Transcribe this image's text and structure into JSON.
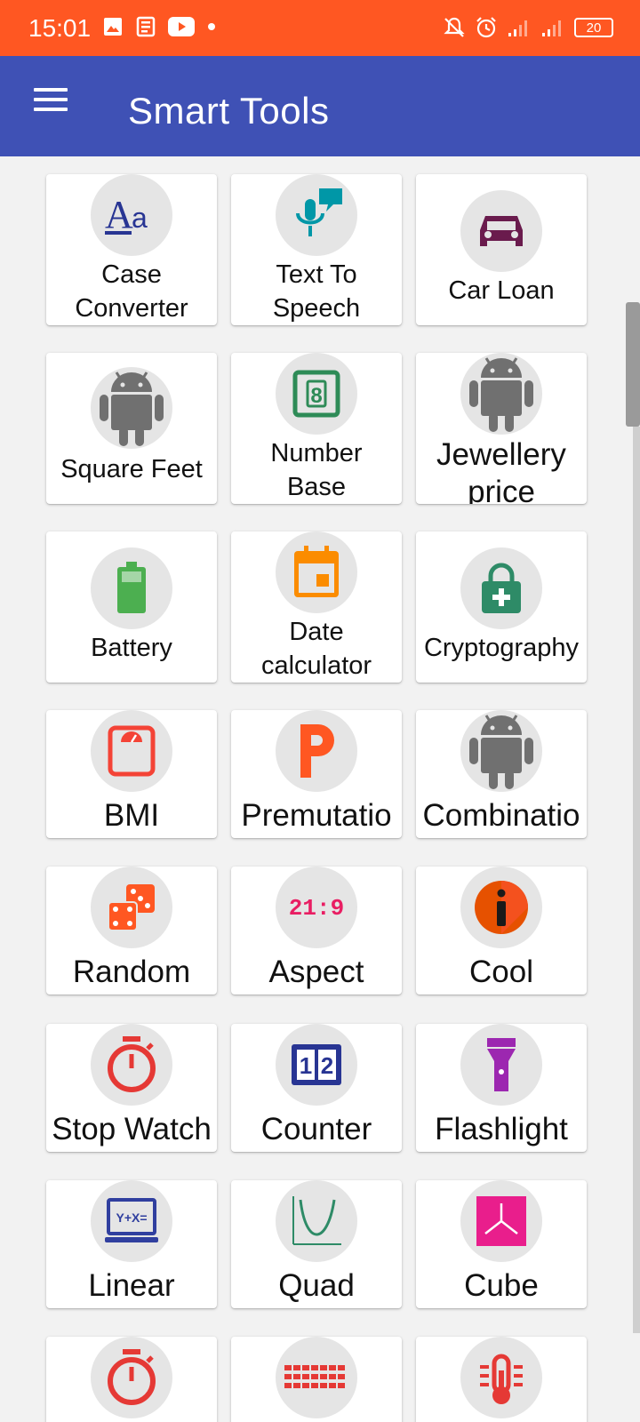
{
  "status_bar": {
    "time": "15:01",
    "battery": "20",
    "background": "#ff5722"
  },
  "app_bar": {
    "title": "Smart Tools",
    "background": "#3f51b5"
  },
  "tools": [
    {
      "label": "Case\nConverter",
      "icon": "case-converter-icon"
    },
    {
      "label": "Text To\nSpeech",
      "icon": "text-to-speech-icon"
    },
    {
      "label": "Car Loan",
      "icon": "car-icon"
    },
    {
      "label": "Square Feet",
      "icon": "android-icon"
    },
    {
      "label": "Number\nBase",
      "icon": "number-base-icon"
    },
    {
      "label": "Jewellery\nprice",
      "icon": "android-icon"
    },
    {
      "label": "Battery",
      "icon": "battery-icon"
    },
    {
      "label": "Date\ncalculator",
      "icon": "calendar-icon"
    },
    {
      "label": "Cryptography",
      "icon": "lock-icon"
    },
    {
      "label": "BMI",
      "icon": "scale-icon"
    },
    {
      "label": "Premutatio",
      "icon": "letter-p-icon"
    },
    {
      "label": "Combinatio",
      "icon": "android-icon"
    },
    {
      "label": "Random",
      "icon": "dice-icon"
    },
    {
      "label": "Aspect",
      "icon": "aspect-ratio-icon"
    },
    {
      "label": "Cool",
      "icon": "info-icon"
    },
    {
      "label": "Stop Watch",
      "icon": "stopwatch-icon"
    },
    {
      "label": "Counter",
      "icon": "counter-icon"
    },
    {
      "label": "Flashlight",
      "icon": "flashlight-icon"
    },
    {
      "label": "Linear",
      "icon": "linear-equation-icon"
    },
    {
      "label": "Quad",
      "icon": "quadratic-graph-icon"
    },
    {
      "label": "Cube",
      "icon": "cube-axes-icon"
    },
    {
      "label": "",
      "icon": "stopwatch-icon"
    },
    {
      "label": "",
      "icon": "equalizer-icon"
    },
    {
      "label": "",
      "icon": "thermometer-icon"
    }
  ],
  "icon_texts": {
    "aspect": "21:9",
    "linear": "Y+X=",
    "counter_left": "1",
    "counter_right": "2",
    "number_base": "8"
  }
}
